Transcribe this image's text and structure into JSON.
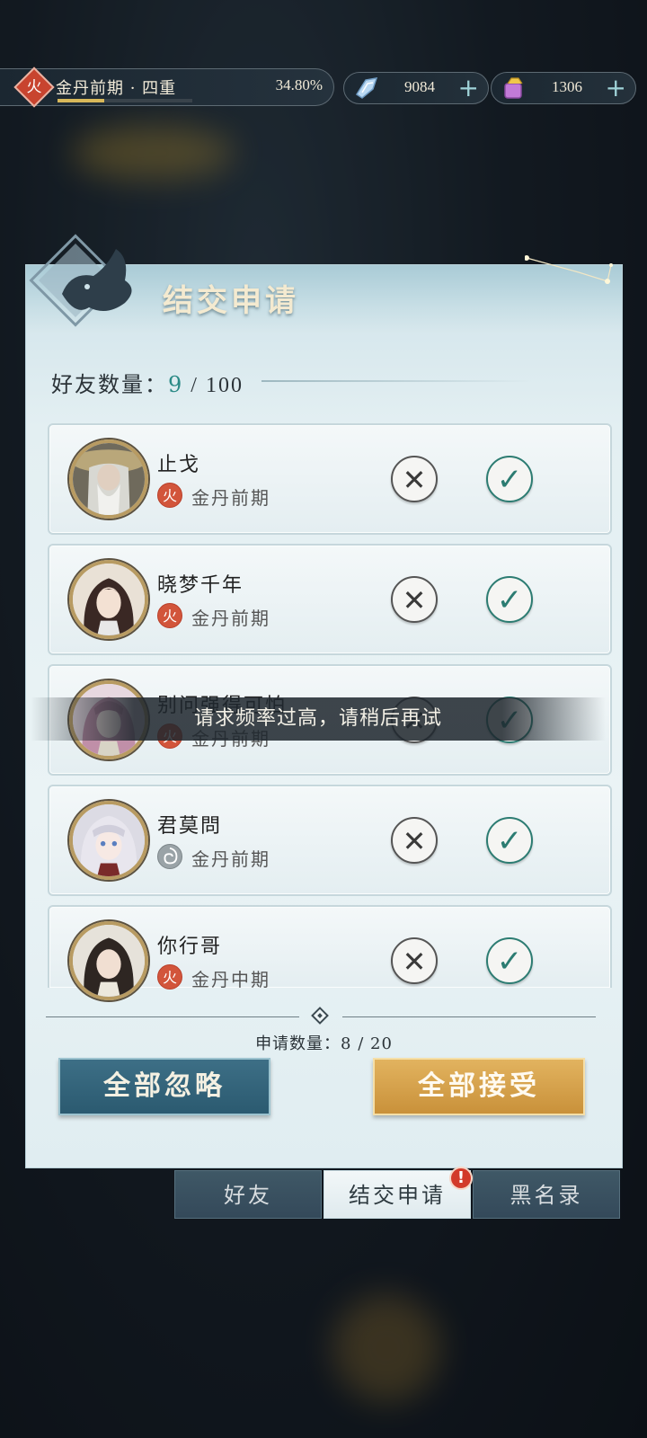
{
  "status_bar": {
    "element": "火",
    "realm": "金丹前期 · 四重",
    "progress_text": "34.80%",
    "progress": 0.348,
    "crystal_value": "9084",
    "jade_value": "1306",
    "plus": "+"
  },
  "panel": {
    "title": "结交申请",
    "friend_count_label": "好友数量：",
    "friend_count": "9",
    "friend_count_sep": " / 100"
  },
  "requests": [
    {
      "name": "止戈",
      "element": "火",
      "element_type": "fire",
      "realm": "金丹前期"
    },
    {
      "name": "晓梦千年",
      "element": "火",
      "element_type": "fire",
      "realm": "金丹前期"
    },
    {
      "name": "别问强得可怕",
      "element": "火",
      "element_type": "fire",
      "realm": "金丹前期"
    },
    {
      "name": "君莫問",
      "element": "",
      "element_type": "wind",
      "realm": "金丹前期"
    },
    {
      "name": "你行哥",
      "element": "火",
      "element_type": "fire",
      "realm": "金丹中期"
    }
  ],
  "buttons": {
    "reject": "✕",
    "accept": "✓",
    "ignore_all": "全部忽略",
    "accept_all": "全部接受"
  },
  "application_count": "申请数量：8 / 20",
  "toast": "请求频率过高，请稍后再试",
  "tabs": [
    {
      "label": "好友"
    },
    {
      "label": "结交申请"
    },
    {
      "label": "黑名录"
    }
  ],
  "alert_badge": "!",
  "colors": {
    "fire": "#d2553b",
    "accept": "#2c7c72",
    "gold": "#d8b85a"
  }
}
